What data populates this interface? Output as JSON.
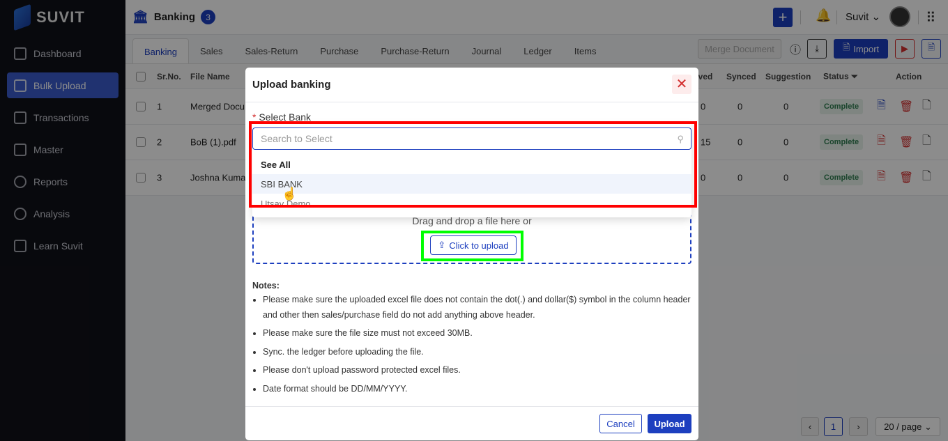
{
  "brand": "SUVIT",
  "sidebar": {
    "items": [
      {
        "label": "Dashboard",
        "icon": "dashboard-icon"
      },
      {
        "label": "Bulk Upload",
        "icon": "folder-upload-icon",
        "active": true
      },
      {
        "label": "Transactions",
        "icon": "transactions-icon"
      },
      {
        "label": "Master",
        "icon": "master-icon"
      },
      {
        "label": "Reports",
        "icon": "pie-chart-icon"
      },
      {
        "label": "Analysis",
        "icon": "analysis-icon"
      },
      {
        "label": "Learn Suvit",
        "icon": "book-icon"
      }
    ]
  },
  "header": {
    "title": "Banking",
    "badge": "3",
    "user": "Suvit"
  },
  "tabs": [
    "Banking",
    "Sales",
    "Sales-Return",
    "Purchase",
    "Purchase-Return",
    "Journal",
    "Ledger",
    "Items"
  ],
  "toolbar": {
    "merge": "Merge Document",
    "import": "Import"
  },
  "table": {
    "headers": {
      "srno": "Sr.No.",
      "file": "File Name",
      "saved": "aved",
      "synced": "Synced",
      "suggestion": "Suggestion",
      "status": "Status",
      "action": "Action"
    },
    "rows": [
      {
        "sr": "1",
        "file": "Merged Docu",
        "saved": "0",
        "synced": "0",
        "suggestion": "0",
        "status": "Complete"
      },
      {
        "sr": "2",
        "file": "BoB (1).pdf",
        "saved": "15",
        "synced": "0",
        "suggestion": "0",
        "status": "Complete"
      },
      {
        "sr": "3",
        "file": "Joshna Kuma",
        "saved": "0",
        "synced": "0",
        "suggestion": "0",
        "status": "Complete"
      }
    ]
  },
  "pagination": {
    "page": "1",
    "per_page": "20 / page"
  },
  "modal": {
    "title": "Upload banking",
    "field_label": "Select Bank",
    "search_placeholder": "Search to Select",
    "options": [
      "See All",
      "SBI BANK",
      "Utsav Demo"
    ],
    "drag_text": "Drag and drop a file here or",
    "upload_label": "Click to upload",
    "notes_title": "Notes:",
    "notes": [
      "Please make sure the uploaded excel file does not contain the dot(.) and dollar($) symbol in the column header and other then sales/purchase field do not add anything above header.",
      "Please make sure the file size must not exceed 30MB.",
      "Sync. the ledger before uploading the file.",
      "Please don't upload password protected excel files.",
      "Date format should be DD/MM/YYYY."
    ],
    "cancel": "Cancel",
    "upload": "Upload"
  },
  "colors": {
    "primary": "#1d3fbf",
    "danger": "#d32f2f",
    "highlight_red": "#ff0000",
    "highlight_green": "#00ff00"
  }
}
